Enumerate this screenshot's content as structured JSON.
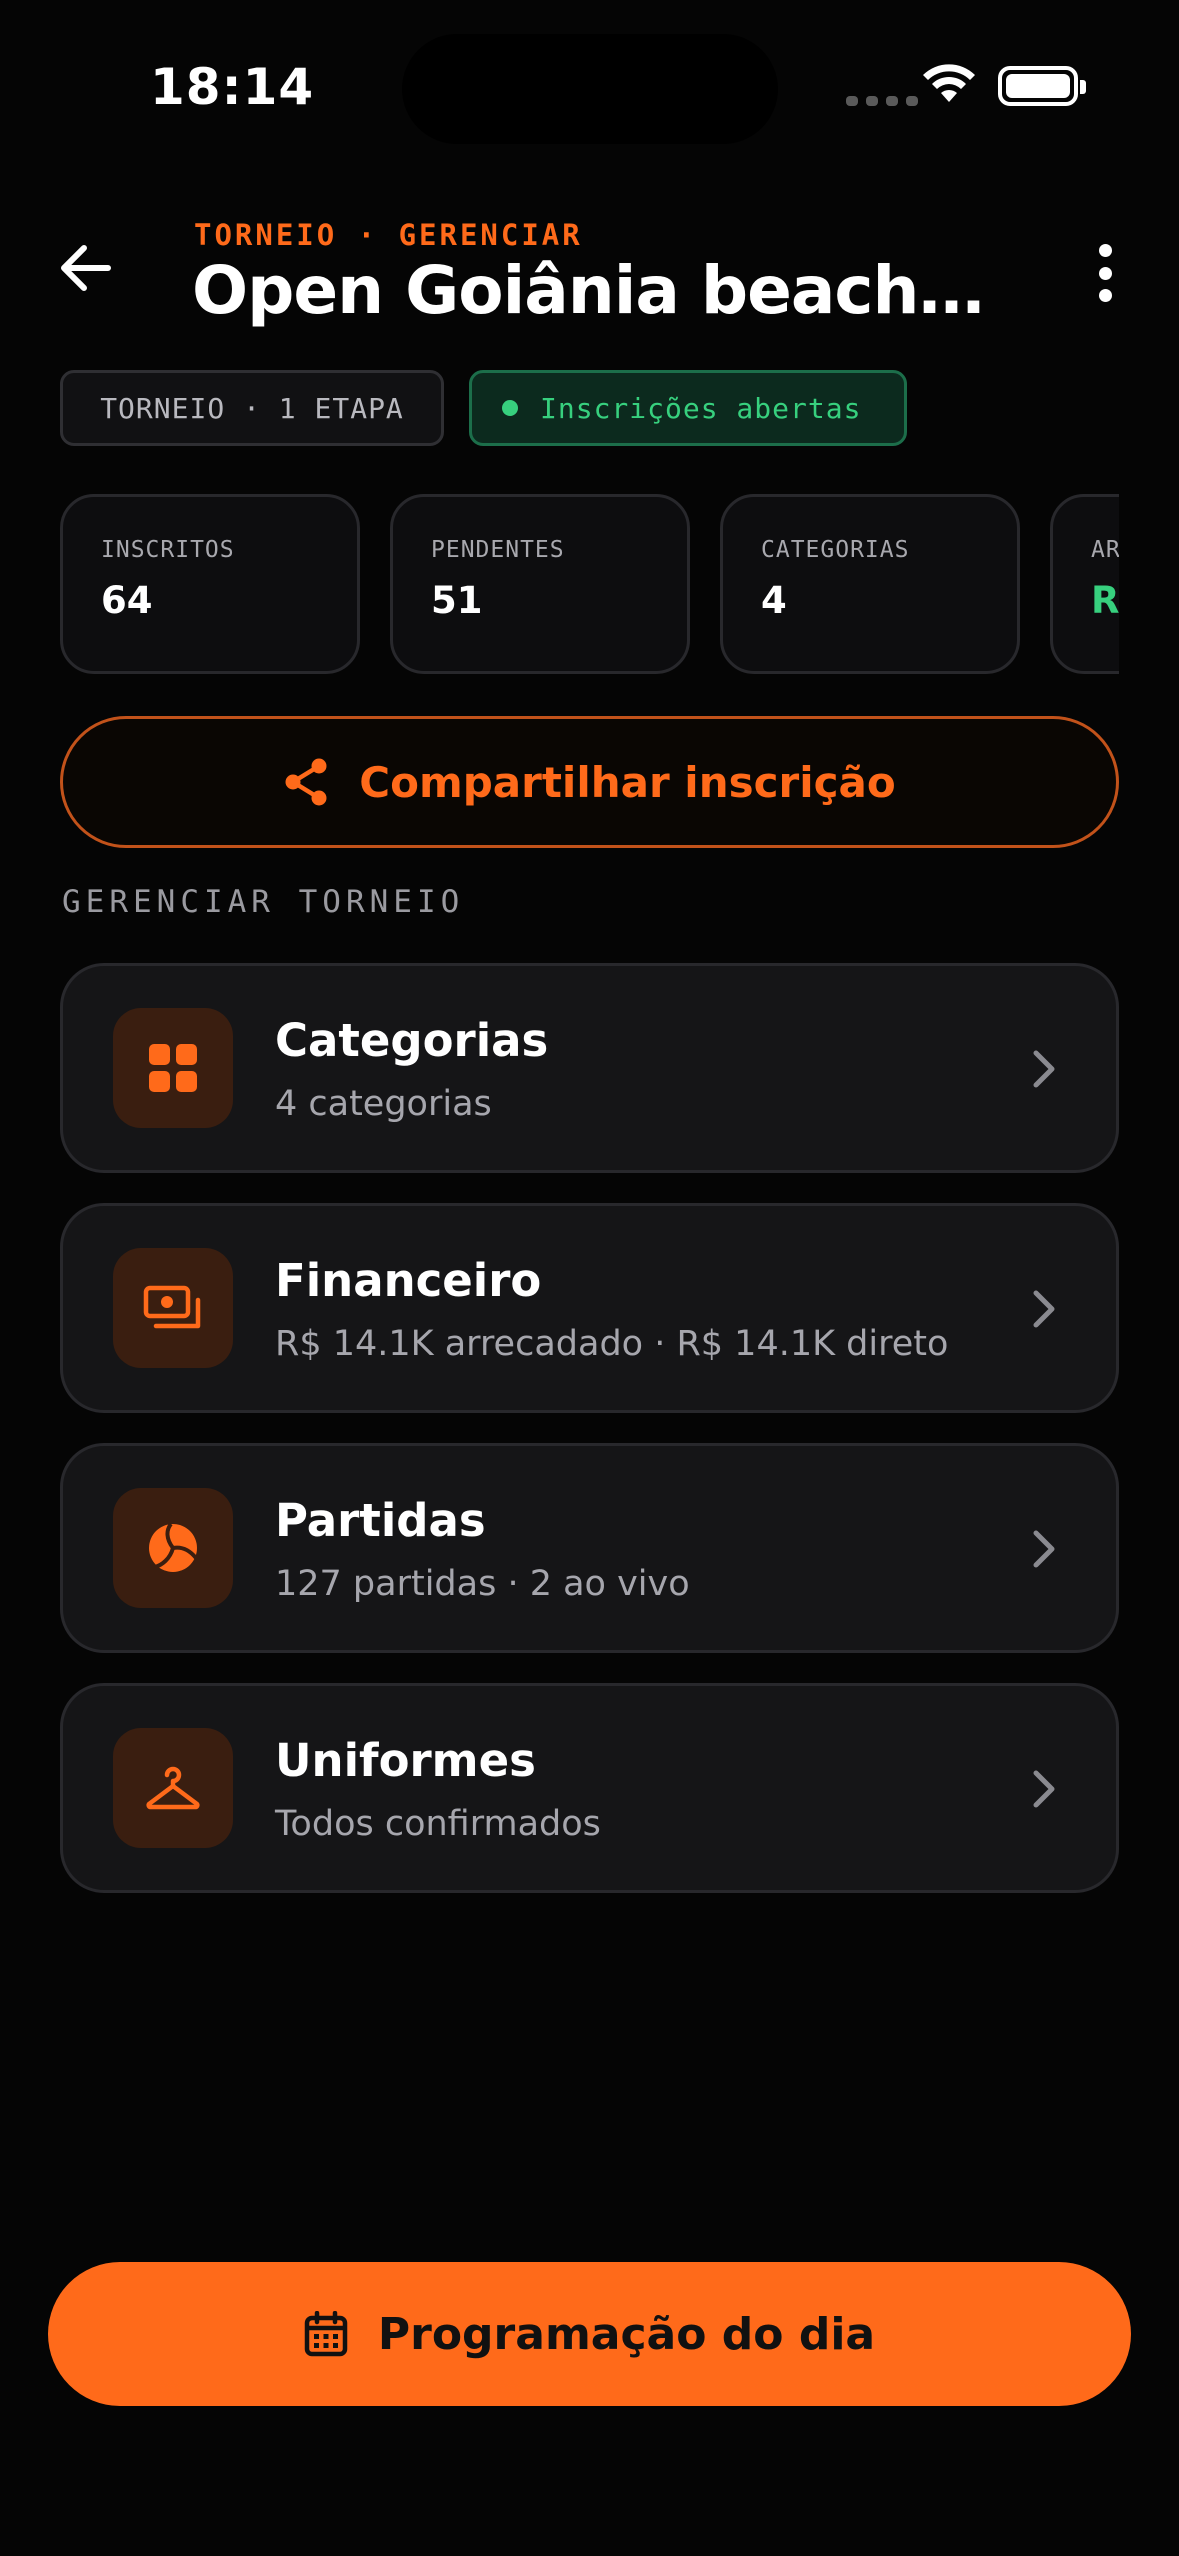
{
  "status_bar": {
    "time": "18:14"
  },
  "header": {
    "eyebrow": "TORNEIO · GERENCIAR",
    "title": "Open Goiânia beach v..."
  },
  "chips": {
    "type": "TORNEIO · 1 ETAPA",
    "status": "Inscrições abertas",
    "status_color": "#37d07e"
  },
  "stats": [
    {
      "label": "INSCRITOS",
      "value": "64"
    },
    {
      "label": "PENDENTES",
      "value": "51"
    },
    {
      "label": "CATEGORIAS",
      "value": "4"
    },
    {
      "label": "AR",
      "value": "R$"
    }
  ],
  "share_button": {
    "label": "Compartilhar inscrição",
    "icon": "share-icon"
  },
  "section_label": "GERENCIAR TORNEIO",
  "menu": [
    {
      "title": "Categorias",
      "subtitle": "4 categorias",
      "icon": "grid-icon"
    },
    {
      "title": "Financeiro",
      "subtitle": "R$ 14.1K arrecadado · R$ 14.1K direto",
      "icon": "money-icon"
    },
    {
      "title": "Partidas",
      "subtitle": "127 partidas · 2 ao vivo",
      "icon": "volleyball-icon"
    },
    {
      "title": "Uniformes",
      "subtitle": "Todos confirmados",
      "icon": "hanger-icon"
    }
  ],
  "cta": {
    "label": "Programação do dia",
    "icon": "calendar-icon"
  },
  "colors": {
    "accent": "#ff6a1a",
    "success": "#37d07e",
    "background": "#050505"
  }
}
